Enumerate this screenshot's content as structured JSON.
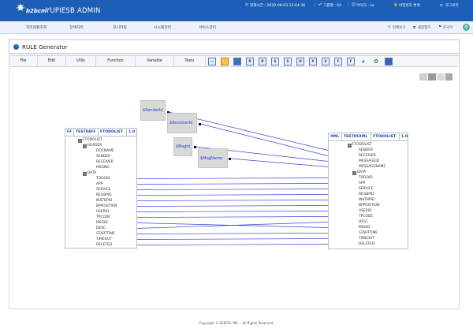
{
  "header": {
    "brand": "b2bcm",
    "title": "YUPIESB ADMIN",
    "current_time": "현재시간 : 2020-09-03 13:44:36",
    "group": "그룹명 : SA",
    "user_id": "아이디 : sa",
    "change_password": "비밀번호 변경",
    "logout": "로그아웃"
  },
  "nav": {
    "items": [
      "처리현황조회",
      "장애처리",
      "모니터링",
      "시스템관리",
      "서비스관리"
    ],
    "links": [
      "전체보기",
      "새창열기",
      "한국어"
    ]
  },
  "page": {
    "title": "RULE Generator"
  },
  "menubar": {
    "items": [
      "File",
      "Edit",
      "Utils",
      "Function",
      "Variable",
      "Tests"
    ],
    "tools": [
      "new",
      "open",
      "save",
      "fn-R1",
      "fn-R2",
      "fn-S1",
      "fn-S2",
      "fn-D",
      "fn-X",
      "fn-X2",
      "fn-F",
      "fn-F2",
      "search",
      "build",
      "run"
    ]
  },
  "source_schema": {
    "type": "FF",
    "name": "TEST04FF",
    "root": "FTODOLIST",
    "version": "1.0",
    "nodes": [
      "FTODOLIST",
      "HEADER",
      "DOCNAME",
      "SENDER",
      "RECEIVER",
      "MSGNO",
      "DATA",
      "TODOID",
      "APP",
      "SERVICE",
      "REGBPID",
      "INSTBPID",
      "BPPOSITION",
      "USERID",
      "TPCODE",
      "MSGID",
      "DESC",
      "STARTTIME",
      "TIMEOUT",
      "DELETED"
    ]
  },
  "target_schema": {
    "type": "XML",
    "name": "TEST05XML",
    "root": "FTODOLIST",
    "version": "1.0",
    "nodes": [
      "FTODOLIST",
      "SENDER",
      "RECEIVER",
      "MESSAGEID",
      "MESSAGENAME",
      "DATA",
      "TODOID",
      "APP",
      "SERVICE",
      "REGBPID",
      "INSTBPID",
      "BPPOSITION",
      "USERID",
      "TPCODE",
      "DESC",
      "MSGID",
      "STARTTIME",
      "TIMEOUT",
      "DELETED"
    ]
  },
  "variables": [
    "$SenderId",
    "$ReceiverId",
    "$MsgId",
    "$MsgName"
  ],
  "footer": {
    "copyright": "Copyright © B2BCM, INC. - All Rights Reserved."
  },
  "colors": {
    "header": "#1d5fb6",
    "line": "#3d46d8",
    "label": "#2147c9"
  }
}
